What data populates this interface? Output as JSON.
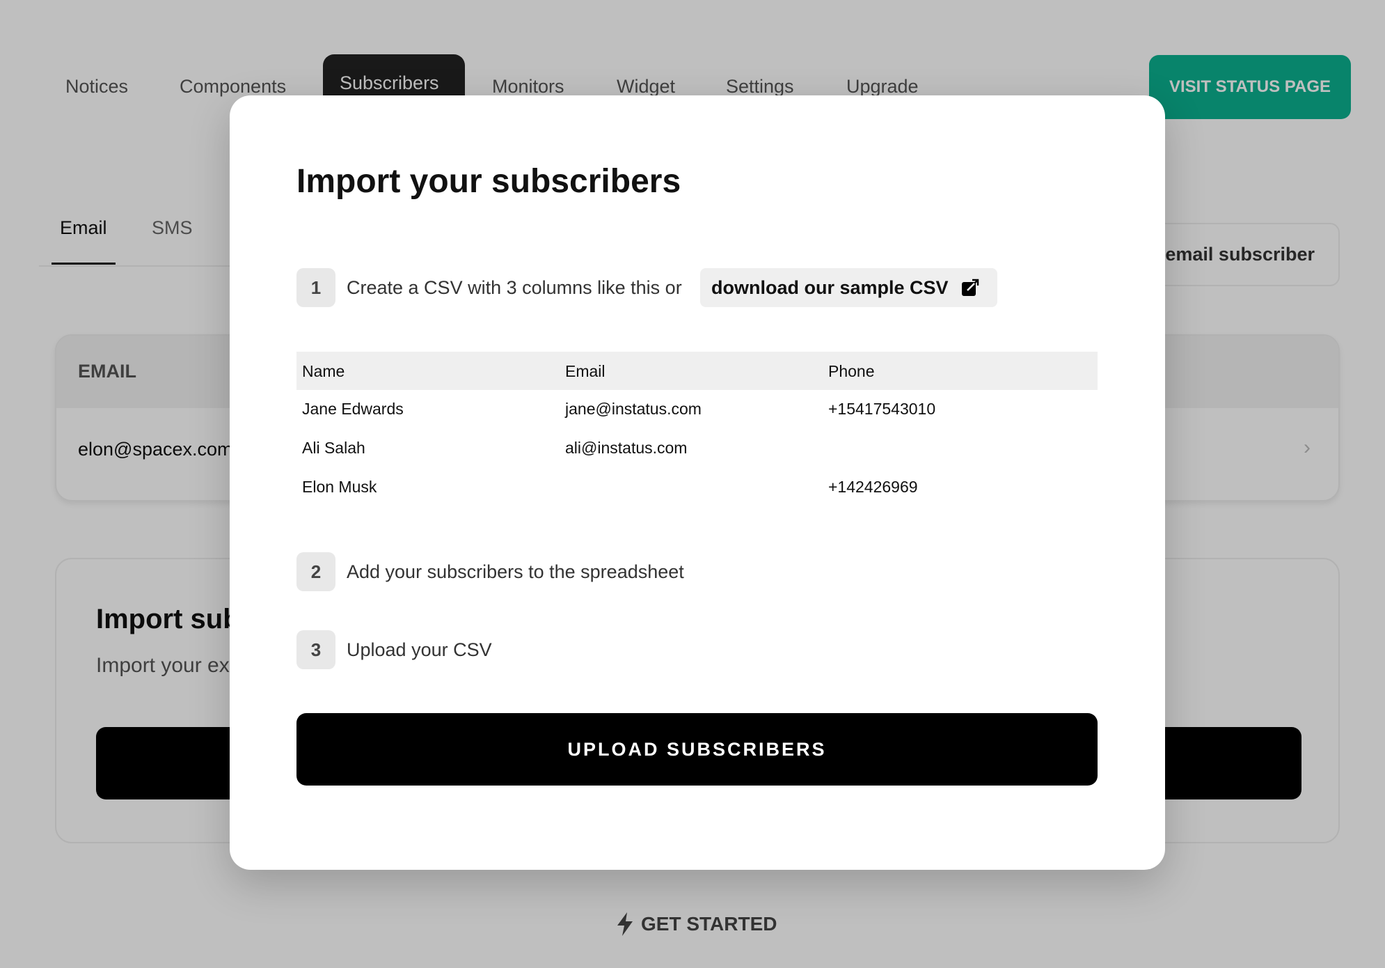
{
  "nav": {
    "tabs": [
      "Notices",
      "Components",
      "Subscribers",
      "Monitors",
      "Widget",
      "Settings",
      "Upgrade"
    ],
    "active": "Subscribers",
    "visit_label": "VISIT STATUS PAGE"
  },
  "subtabs": {
    "email": "Email",
    "sms": "SMS"
  },
  "add_button": "Add email subscriber",
  "email_card": {
    "header": "EMAIL",
    "rows": [
      "elon@spacex.com"
    ]
  },
  "import_card": {
    "title": "Import subscribers",
    "subtitle": "Import your existing subscribers"
  },
  "footer": {
    "get_started": "GET STARTED"
  },
  "modal": {
    "title": "Import your subscribers",
    "steps": [
      {
        "num": "1",
        "text": "Create a CSV with 3 columns like this or",
        "link": "download our sample CSV"
      },
      {
        "num": "2",
        "text": "Add your subscribers to the spreadsheet"
      },
      {
        "num": "3",
        "text": "Upload your CSV"
      }
    ],
    "table": {
      "headers": [
        "Name",
        "Email",
        "Phone"
      ],
      "rows": [
        [
          "Jane Edwards",
          "jane@instatus.com",
          "+15417543010"
        ],
        [
          "Ali Salah",
          "ali@instatus.com",
          ""
        ],
        [
          "Elon Musk",
          "",
          "+142426969"
        ]
      ]
    },
    "upload_label": "UPLOAD SUBSCRIBERS"
  },
  "colors": {
    "accent": "#0bb08f",
    "primary": "#000000"
  }
}
